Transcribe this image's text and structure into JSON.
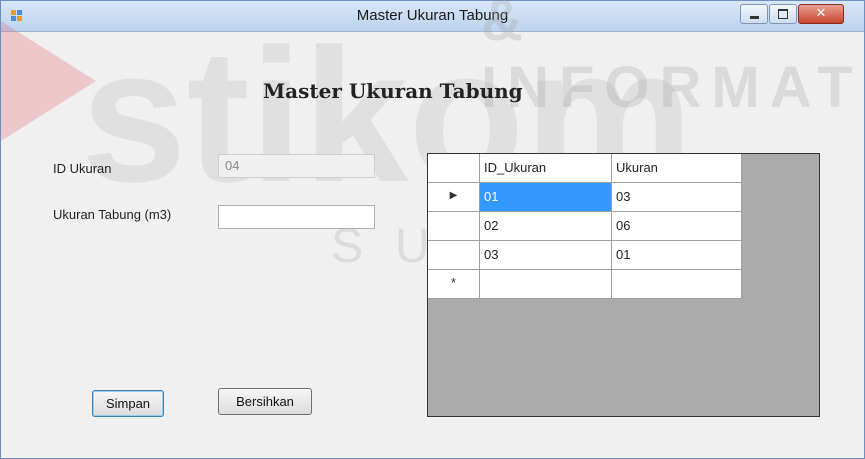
{
  "window": {
    "title": "Master Ukuran Tabung"
  },
  "form": {
    "heading": "Master Ukuran Tabung",
    "id_label": "ID Ukuran",
    "id_value": "04",
    "size_label": "Ukuran Tabung (m3)",
    "size_value": "",
    "save_label": "Simpan",
    "clear_label": "Bersihkan"
  },
  "grid": {
    "columns": [
      "ID_Ukuran",
      "Ukuran"
    ],
    "rows": [
      [
        "01",
        "03"
      ],
      [
        "02",
        "06"
      ],
      [
        "03",
        "01"
      ]
    ],
    "new_row_marker": "*"
  },
  "watermark": {
    "top": "& INFORMATI",
    "big": "stikom",
    "sub": "SURABAYA"
  },
  "colors": {
    "selection": "#3399ff",
    "grid_bg": "#ababab"
  }
}
